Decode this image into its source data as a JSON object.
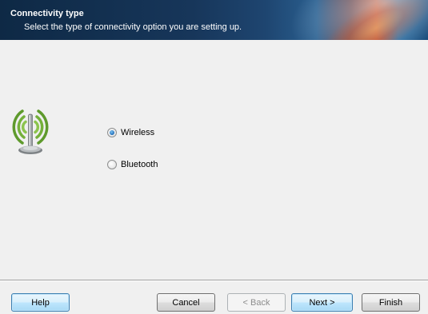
{
  "header": {
    "title": "Connectivity type",
    "subtitle": "Select the type of connectivity option you are setting up."
  },
  "icon": {
    "name": "wireless-antenna-icon",
    "color": "#6aa631"
  },
  "options": [
    {
      "label": "Wireless",
      "selected": true
    },
    {
      "label": "Bluetooth",
      "selected": false
    }
  ],
  "buttons": {
    "help": "Help",
    "cancel": "Cancel",
    "back": "< Back",
    "next": "Next >",
    "finish": "Finish"
  },
  "colors": {
    "accent": "#3c7fb1",
    "header_bg": "#17365a"
  }
}
